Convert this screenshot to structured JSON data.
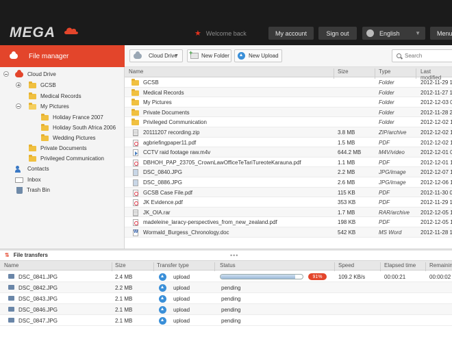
{
  "header": {
    "logo": "MEGA",
    "welcome": "Welcome back",
    "my_account": "My account",
    "sign_out": "Sign out",
    "language": "English",
    "menu": "Menu"
  },
  "sidebar": {
    "title": "File manager",
    "tree": [
      {
        "label": "Cloud Drive",
        "icon": "cloud-icon"
      },
      {
        "label": "GCSB",
        "icon": "folder-icon"
      },
      {
        "label": "Medical Records",
        "icon": "folder-icon"
      },
      {
        "label": "My Pictures",
        "icon": "folder-open-icon"
      },
      {
        "label": "Holiday France 2007",
        "icon": "folder-icon"
      },
      {
        "label": "Holiday South Africa 2006",
        "icon": "folder-icon"
      },
      {
        "label": "Wedding Pictures",
        "icon": "folder-icon"
      },
      {
        "label": "Private Documents",
        "icon": "folder-icon"
      },
      {
        "label": "Privileged Communication",
        "icon": "folder-icon"
      },
      {
        "label": "Contacts",
        "icon": "contacts-icon"
      },
      {
        "label": "Inbox",
        "icon": "inbox-icon"
      },
      {
        "label": "Trash Bin",
        "icon": "trash-icon"
      }
    ]
  },
  "toolbar": {
    "cloud_drive": "Cloud Drive",
    "new_folder": "New Folder",
    "new_upload": "New Upload",
    "search_placeholder": "Search"
  },
  "files": {
    "columns": {
      "name": "Name",
      "size": "Size",
      "type": "Type",
      "modified": "Last modified"
    },
    "rows": [
      {
        "name": "GCSB",
        "size": "",
        "type": "Folder",
        "modified": "2012-11-29 1",
        "icon": "folder"
      },
      {
        "name": "Medical Records",
        "size": "",
        "type": "Folder",
        "modified": "2012-11-27 1",
        "icon": "folder"
      },
      {
        "name": "My Pictures",
        "size": "",
        "type": "Folder",
        "modified": "2012-12-03 0",
        "icon": "folder"
      },
      {
        "name": "Private Documents",
        "size": "",
        "type": "Folder",
        "modified": "2012-11-28 2",
        "icon": "folder"
      },
      {
        "name": "Privileged Communication",
        "size": "",
        "type": "Folder",
        "modified": "2012-12-02 1",
        "icon": "folder"
      },
      {
        "name": "20111207 recording.zip",
        "size": "3.8 MB",
        "type": "ZIP/archive",
        "modified": "2012-12-02 1",
        "icon": "zip"
      },
      {
        "name": "agbriefingpaper11.pdf",
        "size": "1.5 MB",
        "type": "PDF",
        "modified": "2012-12-02 1",
        "icon": "pdf"
      },
      {
        "name": "CCTV raid footage raw.m4v",
        "size": "644.2 MB",
        "type": "M4V/video",
        "modified": "2012-12-01 0",
        "icon": "vid"
      },
      {
        "name": "DBHOH_PAP_23705_CrownLawOfficeTeTariTureoteKaraunа.pdf",
        "size": "1.1 MB",
        "type": "PDF",
        "modified": "2012-12-01 1",
        "icon": "pdf"
      },
      {
        "name": "DSC_0840.JPG",
        "size": "2.2 MB",
        "type": "JPG/image",
        "modified": "2012-12-07 1",
        "icon": "jpg"
      },
      {
        "name": "DSC_0886.JPG",
        "size": "2.6 MB",
        "type": "JPG/image",
        "modified": "2012-12-06 1",
        "icon": "jpg"
      },
      {
        "name": "GCSB Case File.pdf",
        "size": "115 KB",
        "type": "PDF",
        "modified": "2012-11-30 0",
        "icon": "pdf"
      },
      {
        "name": "JK Evidence.pdf",
        "size": "353 KB",
        "type": "PDF",
        "modified": "2012-11-29 1",
        "icon": "pdf"
      },
      {
        "name": "JK_OIA.rar",
        "size": "1.7 MB",
        "type": "RAR/archive",
        "modified": "2012-12-05 1",
        "icon": "zip"
      },
      {
        "name": "madeleine_laracy-perspectives_from_new_zealand.pdf",
        "size": "198 KB",
        "type": "PDF",
        "modified": "2012-12-05 1",
        "icon": "pdf"
      },
      {
        "name": "Wormald_Burgess_Chronology.doc",
        "size": "542 KB",
        "type": "MS Word",
        "modified": "2012-11-28 1",
        "icon": "doc"
      }
    ]
  },
  "transfers": {
    "title": "File transfers",
    "columns": {
      "name": "Name",
      "size": "Size",
      "type": "Transfer type",
      "status": "Status",
      "speed": "Speed",
      "elapsed": "Elapsed time",
      "remaining": "Remaining"
    },
    "rows": [
      {
        "name": "DSC_0841.JPG",
        "size": "2.4 MB",
        "type": "upload",
        "status": "",
        "progress_percent": 91,
        "percent_label": "91%",
        "speed": "109.2 KB/s",
        "elapsed": "00:00:21",
        "remaining": "00:00:02"
      },
      {
        "name": "DSC_0842.JPG",
        "size": "2.2 MB",
        "type": "upload",
        "status": "pending",
        "speed": "",
        "elapsed": "",
        "remaining": ""
      },
      {
        "name": "DSC_0843.JPG",
        "size": "2.1 MB",
        "type": "upload",
        "status": "pending",
        "speed": "",
        "elapsed": "",
        "remaining": ""
      },
      {
        "name": "DSC_0846.JPG",
        "size": "2.1 MB",
        "type": "upload",
        "status": "pending",
        "speed": "",
        "elapsed": "",
        "remaining": ""
      },
      {
        "name": "DSC_0847.JPG",
        "size": "2.1 MB",
        "type": "upload",
        "status": "pending",
        "speed": "",
        "elapsed": "",
        "remaining": ""
      }
    ]
  },
  "colors": {
    "brand_red": "#e3452b",
    "topbar": "#1b1b1b",
    "folder": "#f0c040"
  }
}
